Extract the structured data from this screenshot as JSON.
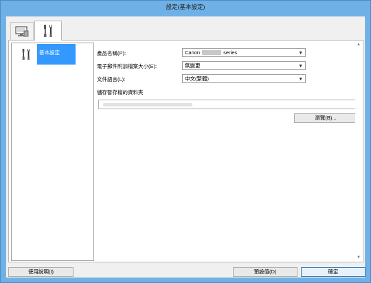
{
  "window": {
    "title": "設定(基本設定)"
  },
  "tabs": [
    {
      "icon": "computer-monitor-icon",
      "active": false
    },
    {
      "icon": "tools-icon",
      "active": true
    }
  ],
  "tree": {
    "items": [
      {
        "label": "基本設定",
        "icon": "tools-icon",
        "selected": true
      }
    ]
  },
  "form": {
    "product_name_label": "產品名稱(P):",
    "product_name_value_prefix": "Canon",
    "product_name_value_suffix": "series",
    "attachment_size_label": "電子郵件附加檔案大小(E):",
    "attachment_size_value": "無變更",
    "doc_language_label": "文件語言(L):",
    "doc_language_value": "中文(繁體)",
    "temp_folder_label": "儲存暫存檔的資料夾",
    "browse_label": "瀏覽(B)..."
  },
  "footer": {
    "help_label": "使用說明(I)",
    "defaults_label": "預設值(D)",
    "ok_label": "確定"
  }
}
